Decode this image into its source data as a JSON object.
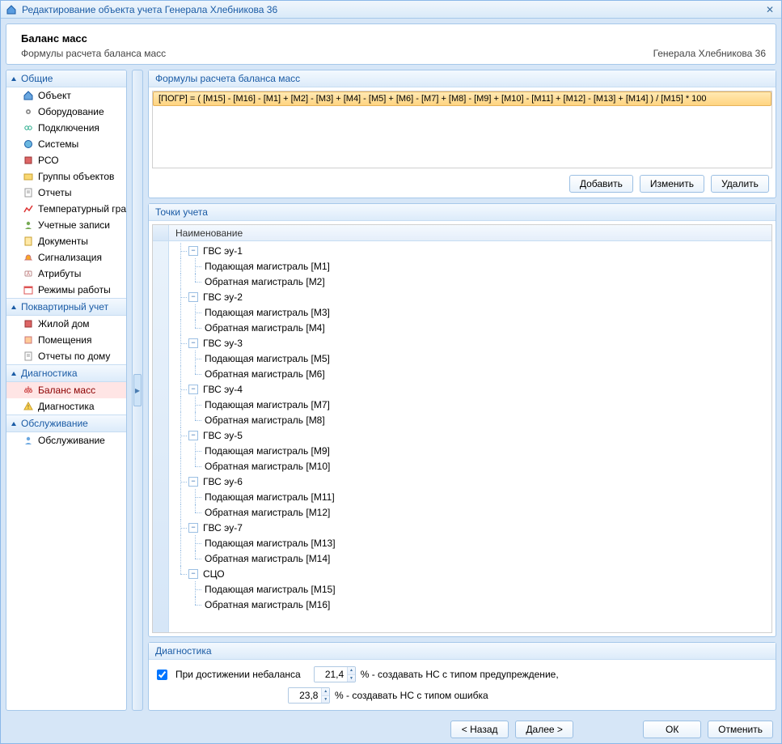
{
  "window": {
    "title": "Редактирование объекта учета Генерала Хлебникова 36"
  },
  "header": {
    "title": "Баланс масс",
    "subtitle": "Формулы расчета баланса масс",
    "context": "Генерала Хлебникова 36"
  },
  "sidebar": {
    "groups": [
      {
        "label": "Общие",
        "items": [
          {
            "label": "Объект",
            "icon": "house-icon"
          },
          {
            "label": "Оборудование",
            "icon": "gear-icon"
          },
          {
            "label": "Подключения",
            "icon": "link-icon"
          },
          {
            "label": "Системы",
            "icon": "globe-icon"
          },
          {
            "label": "РСО",
            "icon": "building-icon"
          },
          {
            "label": "Группы объектов",
            "icon": "folder-icon"
          },
          {
            "label": "Отчеты",
            "icon": "report-icon"
          },
          {
            "label": "Температурный график",
            "icon": "chart-icon"
          },
          {
            "label": "Учетные записи",
            "icon": "user-icon"
          },
          {
            "label": "Документы",
            "icon": "doc-icon"
          },
          {
            "label": "Сигнализация",
            "icon": "bell-icon"
          },
          {
            "label": "Атрибуты",
            "icon": "tag-icon"
          },
          {
            "label": "Режимы работы",
            "icon": "calendar-icon"
          }
        ]
      },
      {
        "label": "Поквартирный учет",
        "items": [
          {
            "label": "Жилой дом",
            "icon": "building-icon"
          },
          {
            "label": "Помещения",
            "icon": "room-icon"
          },
          {
            "label": "Отчеты по дому",
            "icon": "report-icon"
          }
        ]
      },
      {
        "label": "Диагностика",
        "items": [
          {
            "label": "Баланс масс",
            "icon": "balance-icon",
            "selected": true
          },
          {
            "label": "Диагностика",
            "icon": "warning-icon"
          }
        ]
      },
      {
        "label": "Обслуживание",
        "items": [
          {
            "label": "Обслуживание",
            "icon": "service-icon"
          }
        ]
      }
    ]
  },
  "formulas": {
    "panel_title": "Формулы расчета баланса масс",
    "items": [
      "[ПОГР] = ( [M15] - [M16] - [M1] + [M2] - [M3] + [M4] - [M5] + [M6] - [M7] + [M8] - [M9] + [M10] - [M11] + [M12] - [M13] + [M14] ) / [M15] * 100"
    ],
    "buttons": {
      "add": "Добавить",
      "edit": "Изменить",
      "delete": "Удалить"
    }
  },
  "points": {
    "panel_title": "Точки учета",
    "column_header": "Наименование",
    "nodes": [
      {
        "label": "ГВС эу-1",
        "children": [
          "Подающая магистраль [M1]",
          "Обратная магистраль [M2]"
        ]
      },
      {
        "label": "ГВС эу-2",
        "children": [
          "Подающая магистраль [M3]",
          "Обратная магистраль [M4]"
        ]
      },
      {
        "label": "ГВС эу-3",
        "children": [
          "Подающая магистраль [M5]",
          "Обратная магистраль [M6]"
        ]
      },
      {
        "label": "ГВС эу-4",
        "children": [
          "Подающая магистраль [M7]",
          "Обратная магистраль [M8]"
        ]
      },
      {
        "label": "ГВС эу-5",
        "children": [
          "Подающая магистраль [M9]",
          "Обратная магистраль [M10]"
        ]
      },
      {
        "label": "ГВС эу-6",
        "children": [
          "Подающая магистраль [M11]",
          "Обратная магистраль [M12]"
        ]
      },
      {
        "label": "ГВС эу-7",
        "children": [
          "Подающая магистраль [M13]",
          "Обратная магистраль [M14]"
        ]
      },
      {
        "label": "СЦО",
        "children": [
          "Подающая магистраль [M15]",
          "Обратная магистраль [M16]"
        ]
      }
    ]
  },
  "diagnostics": {
    "panel_title": "Диагностика",
    "checkbox_label": "При достижении небаланса",
    "checked": true,
    "warning_value": "21,4",
    "warning_suffix": "% - создавать НС с типом предупреждение,",
    "error_value": "23,8",
    "error_suffix": "% - создавать НС с типом ошибка"
  },
  "footer": {
    "back": "< Назад",
    "next": "Далее >",
    "ok": "ОК",
    "cancel": "Отменить"
  }
}
